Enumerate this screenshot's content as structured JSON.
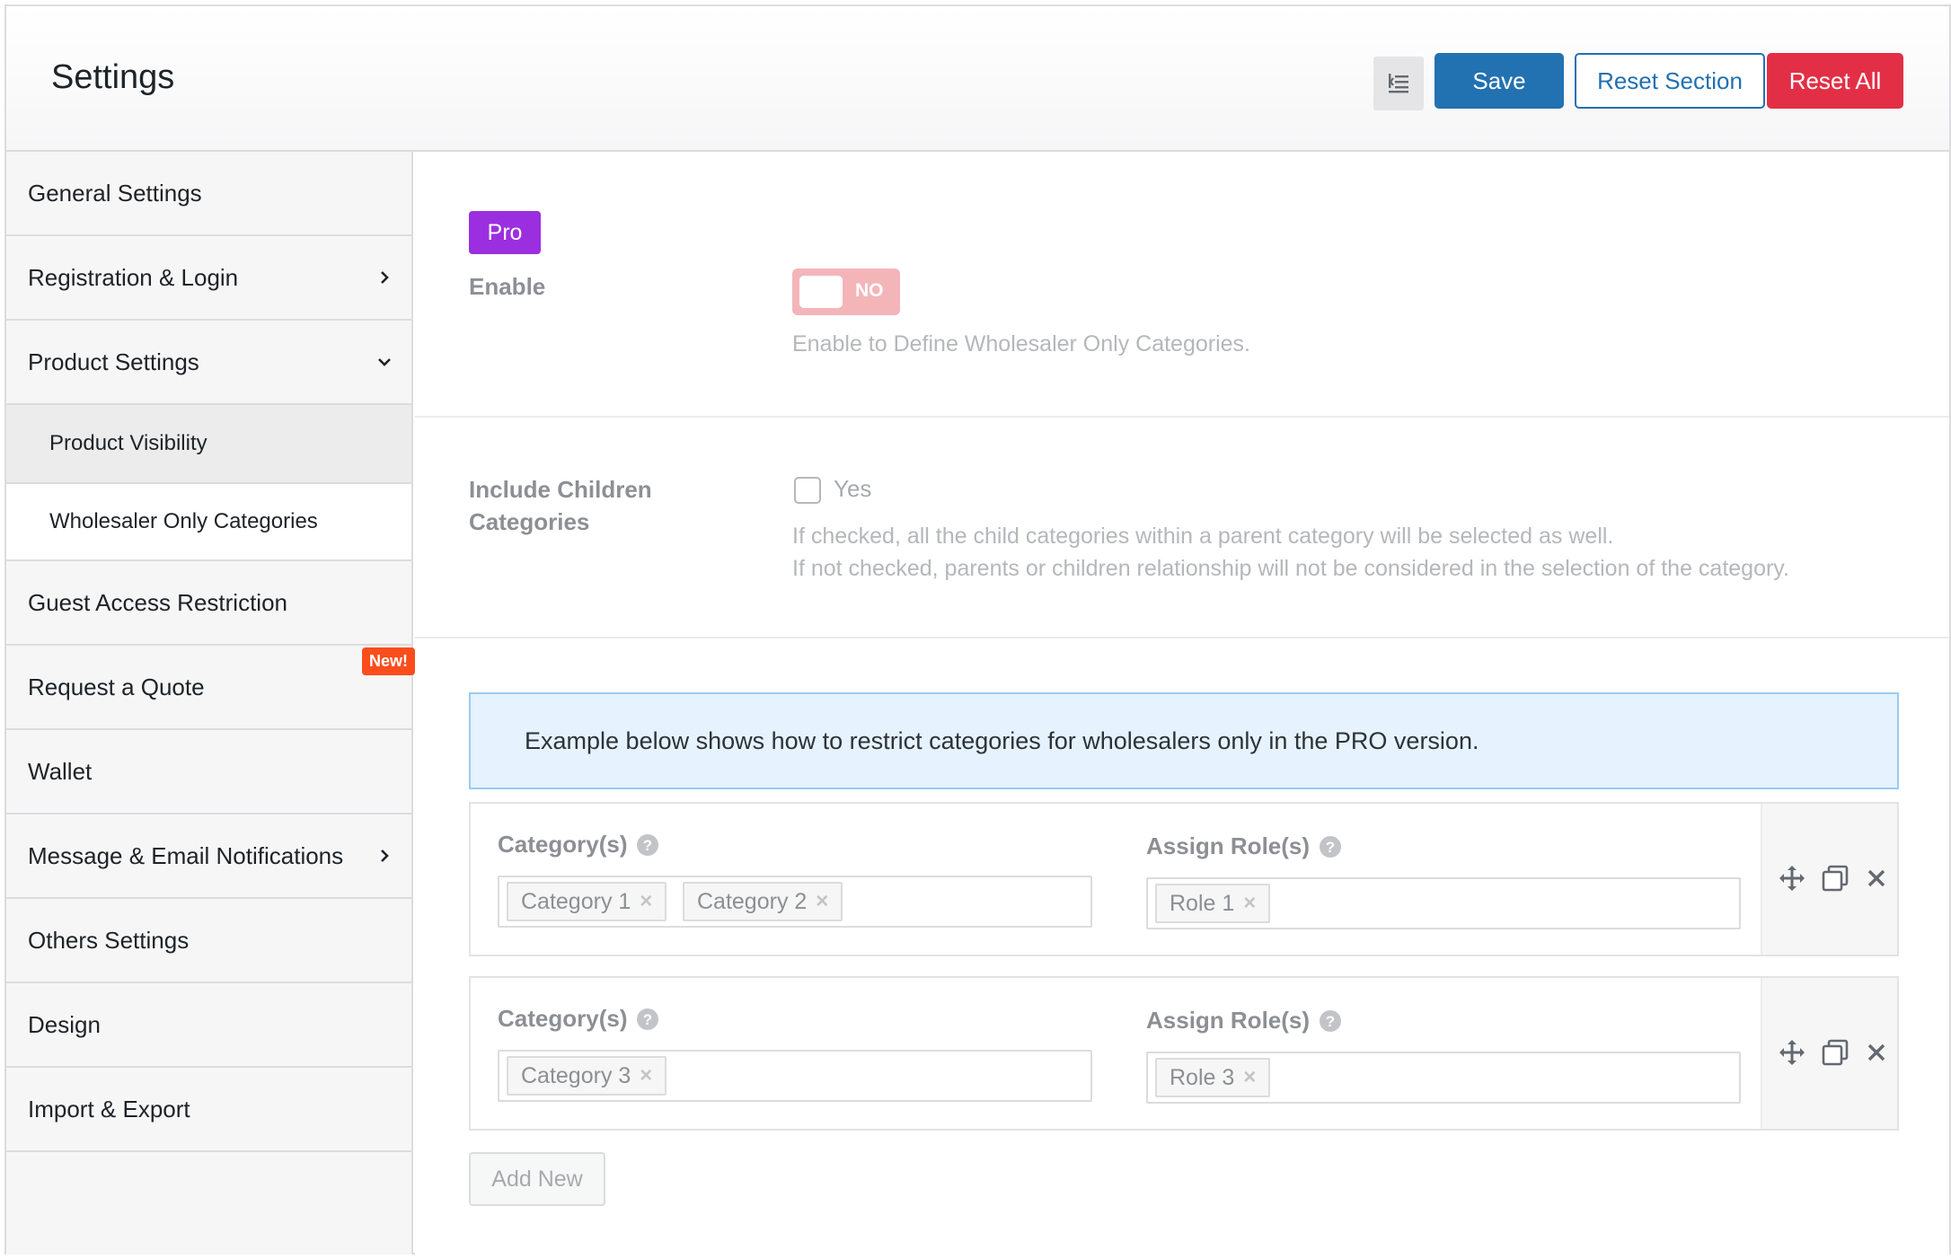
{
  "header": {
    "title": "Settings",
    "icon": "collapse-menu-icon",
    "save_label": "Save",
    "reset_section_label": "Reset Section",
    "reset_all_label": "Reset All"
  },
  "sidebar": {
    "items": [
      {
        "label": "General Settings"
      },
      {
        "label": "Registration & Login",
        "icon": "chevron-right-icon"
      },
      {
        "label": "Product Settings",
        "icon": "chevron-down-icon"
      },
      {
        "label": "Product Visibility"
      },
      {
        "label": "Wholesaler Only Categories",
        "active": true
      },
      {
        "label": "Guest Access Restriction"
      },
      {
        "label": "Request a Quote",
        "badge": "New!"
      },
      {
        "label": "Wallet"
      },
      {
        "label": "Message & Email Notifications",
        "icon": "chevron-right-icon"
      },
      {
        "label": "Others Settings"
      },
      {
        "label": "Design"
      },
      {
        "label": "Import & Export"
      }
    ]
  },
  "main": {
    "pro_badge": "Pro",
    "enable": {
      "label": "Enable",
      "toggle_text": "NO",
      "help": "Enable to Define Wholesaler Only Categories."
    },
    "include_children": {
      "label_line1": "Include Children",
      "label_line2": "Categories",
      "checkbox_label": "Yes",
      "help_line1": "If checked, all the child categories within a parent category will be selected as well.",
      "help_line2": "If not checked, parents or children relationship will not be considered in the selection of the category."
    },
    "notice": "Example below shows how to restrict categories for wholesalers only in the PRO version.",
    "rules": [
      {
        "category_label": "Category(s)",
        "role_label": "Assign Role(s)",
        "categories": [
          "Category 1",
          "Category 2"
        ],
        "roles": [
          "Role 1"
        ]
      },
      {
        "category_label": "Category(s)",
        "role_label": "Assign Role(s)",
        "categories": [
          "Category 3"
        ],
        "roles": [
          "Role 3"
        ]
      }
    ],
    "remove_symbol": "×",
    "add_new_label": "Add New"
  },
  "colors": {
    "primary": "#2271b1",
    "danger": "#e22f45",
    "pro": "#9b2fe0",
    "new_badge": "#fa4d1c",
    "toggle_off": "#f4b5b9"
  }
}
